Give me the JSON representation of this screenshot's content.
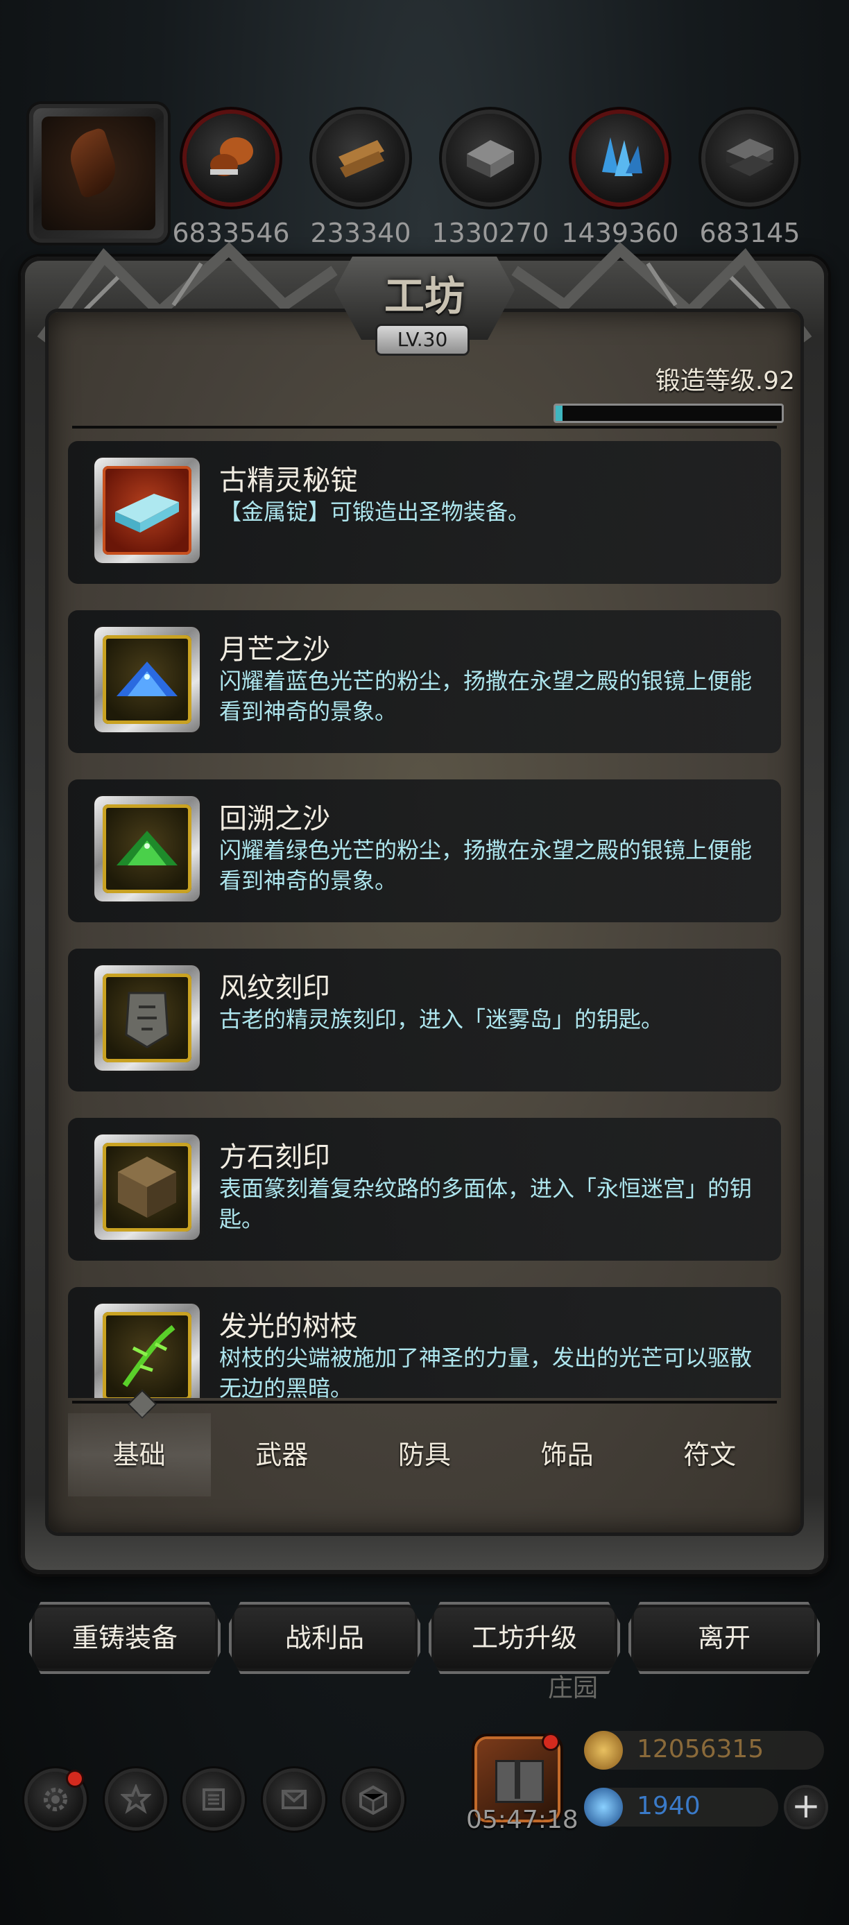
{
  "resources": {
    "items": [
      {
        "icon": "leather-icon",
        "value": "6833546"
      },
      {
        "icon": "wood-planks-icon",
        "value": "233340"
      },
      {
        "icon": "iron-ingot-icon",
        "value": "1330270"
      },
      {
        "icon": "blue-crystal-icon",
        "value": "1439360"
      },
      {
        "icon": "steel-ingot-icon",
        "value": "683145"
      }
    ]
  },
  "workshop": {
    "title": "工坊",
    "level": "LV.30",
    "forge_label": "锻造等级.92",
    "forge_progress": 0.03
  },
  "items": [
    {
      "name": "古精灵秘锭",
      "desc": "【金属锭】可锻造出圣物装备。",
      "icon": "ingot-icon",
      "frame": "red"
    },
    {
      "name": "月芒之沙",
      "desc": "闪耀着蓝色光芒的粉尘，扬撒在永望之殿的银镜上便能看到神奇的景象。",
      "icon": "blue-sand-icon",
      "frame": "gold"
    },
    {
      "name": "回溯之沙",
      "desc": "闪耀着绿色光芒的粉尘，扬撒在永望之殿的银镜上便能看到神奇的景象。",
      "icon": "green-sand-icon",
      "frame": "gold"
    },
    {
      "name": "风纹刻印",
      "desc": "古老的精灵族刻印，进入「迷雾岛」的钥匙。",
      "icon": "rune-plate-icon",
      "frame": "gold"
    },
    {
      "name": "方石刻印",
      "desc": "表面篆刻着复杂纹路的多面体，进入「永恒迷宫」的钥匙。",
      "icon": "stone-cube-icon",
      "frame": "gold"
    },
    {
      "name": "发光的树枝",
      "desc": "树枝的尖端被施加了神圣的力量，发出的光芒可以驱散无边的黑暗。",
      "icon": "glowing-branch-icon",
      "frame": "gold"
    }
  ],
  "tabs": [
    {
      "label": "基础",
      "active": true
    },
    {
      "label": "武器",
      "active": false
    },
    {
      "label": "防具",
      "active": false
    },
    {
      "label": "饰品",
      "active": false
    },
    {
      "label": "符文",
      "active": false
    }
  ],
  "actions": {
    "recast": "重铸装备",
    "loot": "战利品",
    "upgrade": "工坊升级",
    "leave": "离开"
  },
  "hud": {
    "manor": "庄园",
    "timer": "05:47:18",
    "gold": "12056315",
    "gems": "1940",
    "plus": "+",
    "icons": [
      "settings-gear-icon",
      "badge-icon",
      "crest-icon",
      "mail-icon",
      "cube-icon"
    ]
  },
  "colors": {
    "accent_cyan": "#3fb6c0",
    "desc_text": "#aee6ee",
    "gold_frame": "#c9a222",
    "red_frame": "#c8501e",
    "gold_text": "#8a6a3a",
    "gem_text": "#3a7ac8"
  }
}
